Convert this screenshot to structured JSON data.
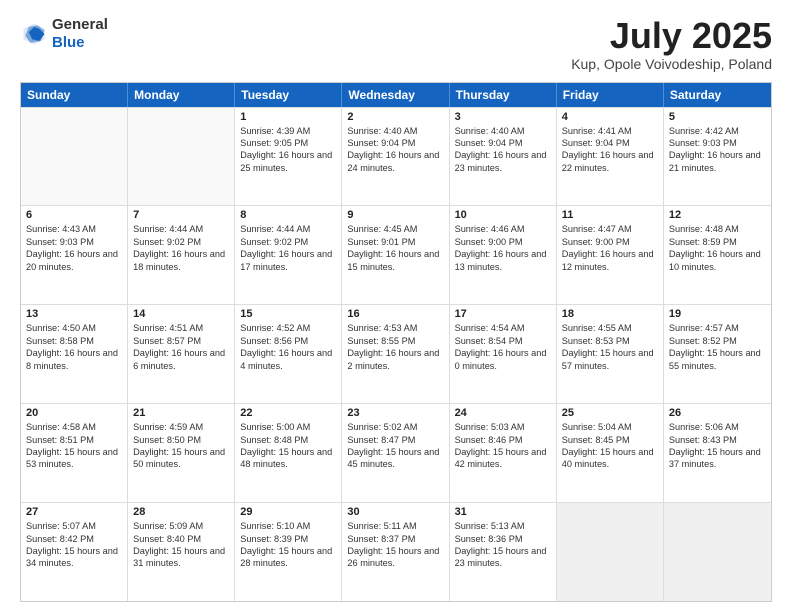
{
  "header": {
    "logo_line1": "General",
    "logo_line2": "Blue",
    "month": "July 2025",
    "location": "Kup, Opole Voivodeship, Poland"
  },
  "weekdays": [
    "Sunday",
    "Monday",
    "Tuesday",
    "Wednesday",
    "Thursday",
    "Friday",
    "Saturday"
  ],
  "rows": [
    [
      {
        "day": "",
        "sunrise": "",
        "sunset": "",
        "daylight": ""
      },
      {
        "day": "",
        "sunrise": "",
        "sunset": "",
        "daylight": ""
      },
      {
        "day": "1",
        "sunrise": "Sunrise: 4:39 AM",
        "sunset": "Sunset: 9:05 PM",
        "daylight": "Daylight: 16 hours and 25 minutes."
      },
      {
        "day": "2",
        "sunrise": "Sunrise: 4:40 AM",
        "sunset": "Sunset: 9:04 PM",
        "daylight": "Daylight: 16 hours and 24 minutes."
      },
      {
        "day": "3",
        "sunrise": "Sunrise: 4:40 AM",
        "sunset": "Sunset: 9:04 PM",
        "daylight": "Daylight: 16 hours and 23 minutes."
      },
      {
        "day": "4",
        "sunrise": "Sunrise: 4:41 AM",
        "sunset": "Sunset: 9:04 PM",
        "daylight": "Daylight: 16 hours and 22 minutes."
      },
      {
        "day": "5",
        "sunrise": "Sunrise: 4:42 AM",
        "sunset": "Sunset: 9:03 PM",
        "daylight": "Daylight: 16 hours and 21 minutes."
      }
    ],
    [
      {
        "day": "6",
        "sunrise": "Sunrise: 4:43 AM",
        "sunset": "Sunset: 9:03 PM",
        "daylight": "Daylight: 16 hours and 20 minutes."
      },
      {
        "day": "7",
        "sunrise": "Sunrise: 4:44 AM",
        "sunset": "Sunset: 9:02 PM",
        "daylight": "Daylight: 16 hours and 18 minutes."
      },
      {
        "day": "8",
        "sunrise": "Sunrise: 4:44 AM",
        "sunset": "Sunset: 9:02 PM",
        "daylight": "Daylight: 16 hours and 17 minutes."
      },
      {
        "day": "9",
        "sunrise": "Sunrise: 4:45 AM",
        "sunset": "Sunset: 9:01 PM",
        "daylight": "Daylight: 16 hours and 15 minutes."
      },
      {
        "day": "10",
        "sunrise": "Sunrise: 4:46 AM",
        "sunset": "Sunset: 9:00 PM",
        "daylight": "Daylight: 16 hours and 13 minutes."
      },
      {
        "day": "11",
        "sunrise": "Sunrise: 4:47 AM",
        "sunset": "Sunset: 9:00 PM",
        "daylight": "Daylight: 16 hours and 12 minutes."
      },
      {
        "day": "12",
        "sunrise": "Sunrise: 4:48 AM",
        "sunset": "Sunset: 8:59 PM",
        "daylight": "Daylight: 16 hours and 10 minutes."
      }
    ],
    [
      {
        "day": "13",
        "sunrise": "Sunrise: 4:50 AM",
        "sunset": "Sunset: 8:58 PM",
        "daylight": "Daylight: 16 hours and 8 minutes."
      },
      {
        "day": "14",
        "sunrise": "Sunrise: 4:51 AM",
        "sunset": "Sunset: 8:57 PM",
        "daylight": "Daylight: 16 hours and 6 minutes."
      },
      {
        "day": "15",
        "sunrise": "Sunrise: 4:52 AM",
        "sunset": "Sunset: 8:56 PM",
        "daylight": "Daylight: 16 hours and 4 minutes."
      },
      {
        "day": "16",
        "sunrise": "Sunrise: 4:53 AM",
        "sunset": "Sunset: 8:55 PM",
        "daylight": "Daylight: 16 hours and 2 minutes."
      },
      {
        "day": "17",
        "sunrise": "Sunrise: 4:54 AM",
        "sunset": "Sunset: 8:54 PM",
        "daylight": "Daylight: 16 hours and 0 minutes."
      },
      {
        "day": "18",
        "sunrise": "Sunrise: 4:55 AM",
        "sunset": "Sunset: 8:53 PM",
        "daylight": "Daylight: 15 hours and 57 minutes."
      },
      {
        "day": "19",
        "sunrise": "Sunrise: 4:57 AM",
        "sunset": "Sunset: 8:52 PM",
        "daylight": "Daylight: 15 hours and 55 minutes."
      }
    ],
    [
      {
        "day": "20",
        "sunrise": "Sunrise: 4:58 AM",
        "sunset": "Sunset: 8:51 PM",
        "daylight": "Daylight: 15 hours and 53 minutes."
      },
      {
        "day": "21",
        "sunrise": "Sunrise: 4:59 AM",
        "sunset": "Sunset: 8:50 PM",
        "daylight": "Daylight: 15 hours and 50 minutes."
      },
      {
        "day": "22",
        "sunrise": "Sunrise: 5:00 AM",
        "sunset": "Sunset: 8:48 PM",
        "daylight": "Daylight: 15 hours and 48 minutes."
      },
      {
        "day": "23",
        "sunrise": "Sunrise: 5:02 AM",
        "sunset": "Sunset: 8:47 PM",
        "daylight": "Daylight: 15 hours and 45 minutes."
      },
      {
        "day": "24",
        "sunrise": "Sunrise: 5:03 AM",
        "sunset": "Sunset: 8:46 PM",
        "daylight": "Daylight: 15 hours and 42 minutes."
      },
      {
        "day": "25",
        "sunrise": "Sunrise: 5:04 AM",
        "sunset": "Sunset: 8:45 PM",
        "daylight": "Daylight: 15 hours and 40 minutes."
      },
      {
        "day": "26",
        "sunrise": "Sunrise: 5:06 AM",
        "sunset": "Sunset: 8:43 PM",
        "daylight": "Daylight: 15 hours and 37 minutes."
      }
    ],
    [
      {
        "day": "27",
        "sunrise": "Sunrise: 5:07 AM",
        "sunset": "Sunset: 8:42 PM",
        "daylight": "Daylight: 15 hours and 34 minutes."
      },
      {
        "day": "28",
        "sunrise": "Sunrise: 5:09 AM",
        "sunset": "Sunset: 8:40 PM",
        "daylight": "Daylight: 15 hours and 31 minutes."
      },
      {
        "day": "29",
        "sunrise": "Sunrise: 5:10 AM",
        "sunset": "Sunset: 8:39 PM",
        "daylight": "Daylight: 15 hours and 28 minutes."
      },
      {
        "day": "30",
        "sunrise": "Sunrise: 5:11 AM",
        "sunset": "Sunset: 8:37 PM",
        "daylight": "Daylight: 15 hours and 26 minutes."
      },
      {
        "day": "31",
        "sunrise": "Sunrise: 5:13 AM",
        "sunset": "Sunset: 8:36 PM",
        "daylight": "Daylight: 15 hours and 23 minutes."
      },
      {
        "day": "",
        "sunrise": "",
        "sunset": "",
        "daylight": ""
      },
      {
        "day": "",
        "sunrise": "",
        "sunset": "",
        "daylight": ""
      }
    ]
  ]
}
